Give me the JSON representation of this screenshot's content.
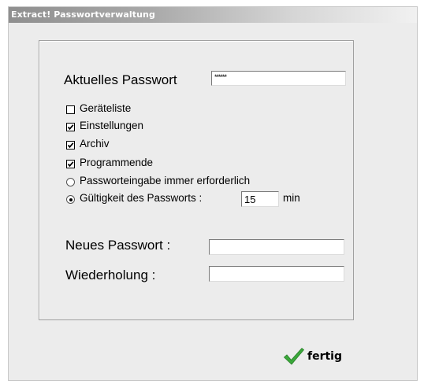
{
  "window": {
    "title": "Extract! Passwortverwaltung"
  },
  "current_password": {
    "label": "Aktuelles Passwort",
    "value": "******"
  },
  "permissions": [
    {
      "label": "Geräteliste",
      "checked": false
    },
    {
      "label": "Einstellungen",
      "checked": true
    },
    {
      "label": "Archiv",
      "checked": true
    },
    {
      "label": "Programmende",
      "checked": true
    }
  ],
  "mode": {
    "always_label": "Passworteingabe immer erforderlich",
    "validity_label": "Gültigkeit des Passworts :",
    "validity_value": "15",
    "unit": "min",
    "selected": "validity"
  },
  "new_password": {
    "label": "Neues Passwort :",
    "value": ""
  },
  "repeat_password": {
    "label": "Wiederholung :",
    "value": ""
  },
  "done_button": {
    "label": "fertig",
    "icon": "checkmark-icon",
    "icon_color": "#3aa83a"
  }
}
